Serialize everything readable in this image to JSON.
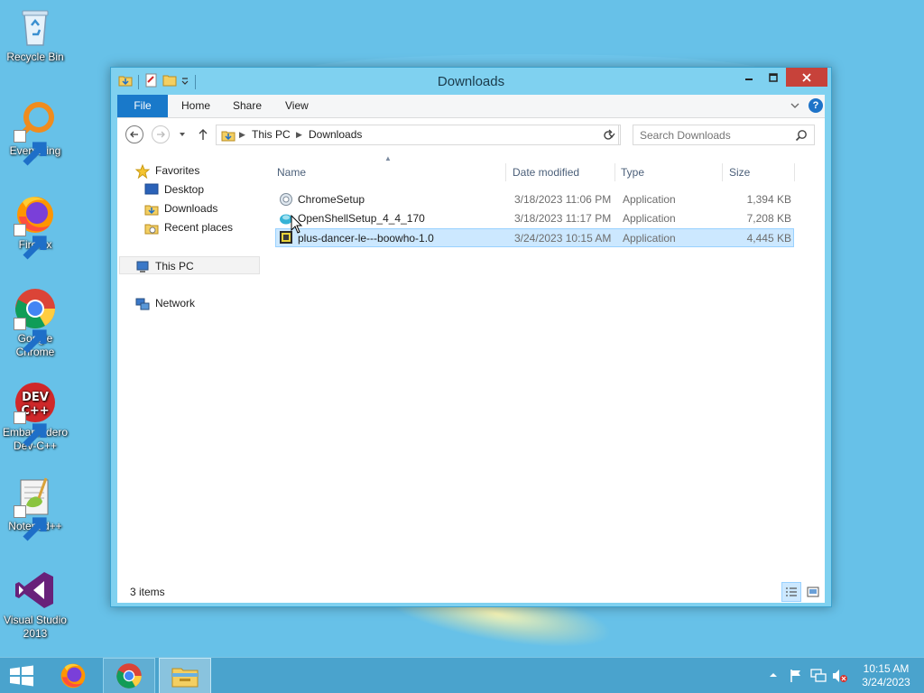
{
  "desktop": {
    "icons": [
      {
        "label": "Recycle Bin",
        "icon": "recycle-bin-icon"
      },
      {
        "label": "Everything",
        "icon": "everything-search-icon"
      },
      {
        "label": "Firefox",
        "icon": "firefox-icon"
      },
      {
        "label": "Google Chrome",
        "icon": "chrome-icon"
      },
      {
        "label": "Embarcadero Dev-C++",
        "icon": "devcpp-icon"
      },
      {
        "label": "Notepad++",
        "icon": "notepadpp-icon"
      },
      {
        "label": "Visual Studio 2013",
        "icon": "visual-studio-icon"
      }
    ]
  },
  "window": {
    "title": "Downloads",
    "ribbon_tabs": [
      "File",
      "Home",
      "Share",
      "View"
    ],
    "help_label": "?",
    "breadcrumb": [
      "This PC",
      "Downloads"
    ],
    "search_placeholder": "Search Downloads",
    "nav_pane": {
      "favorites": "Favorites",
      "favorite_items": [
        "Desktop",
        "Downloads",
        "Recent places"
      ],
      "this_pc": "This PC",
      "network": "Network"
    },
    "columns": [
      "Name",
      "Date modified",
      "Type",
      "Size"
    ],
    "files": [
      {
        "name": "ChromeSetup",
        "date": "3/18/2023 11:06 PM",
        "type": "Application",
        "size": "1,394 KB",
        "icon": "chrome-setup-icon",
        "selected": false
      },
      {
        "name": "OpenShellSetup_4_4_170",
        "date": "3/18/2023 11:17 PM",
        "type": "Application",
        "size": "7,208 KB",
        "icon": "openshell-setup-icon",
        "selected": false
      },
      {
        "name": "plus-dancer-le---boowho-1.0",
        "date": "3/24/2023 10:15 AM",
        "type": "Application",
        "size": "4,445 KB",
        "icon": "exe-app-icon",
        "selected": true
      }
    ],
    "status": "3 items"
  },
  "taskbar": {
    "apps": [
      "Start",
      "Firefox",
      "Google Chrome",
      "File Explorer"
    ],
    "clock_time": "10:15 AM",
    "clock_date": "3/24/2023"
  },
  "colors": {
    "desktop_bg": "#67c1e8",
    "window_frame": "#7fd1f0",
    "file_tab": "#1979ca",
    "close_button": "#c7423a",
    "selection": "#cce8ff",
    "taskbar": "#4aa3cd"
  }
}
